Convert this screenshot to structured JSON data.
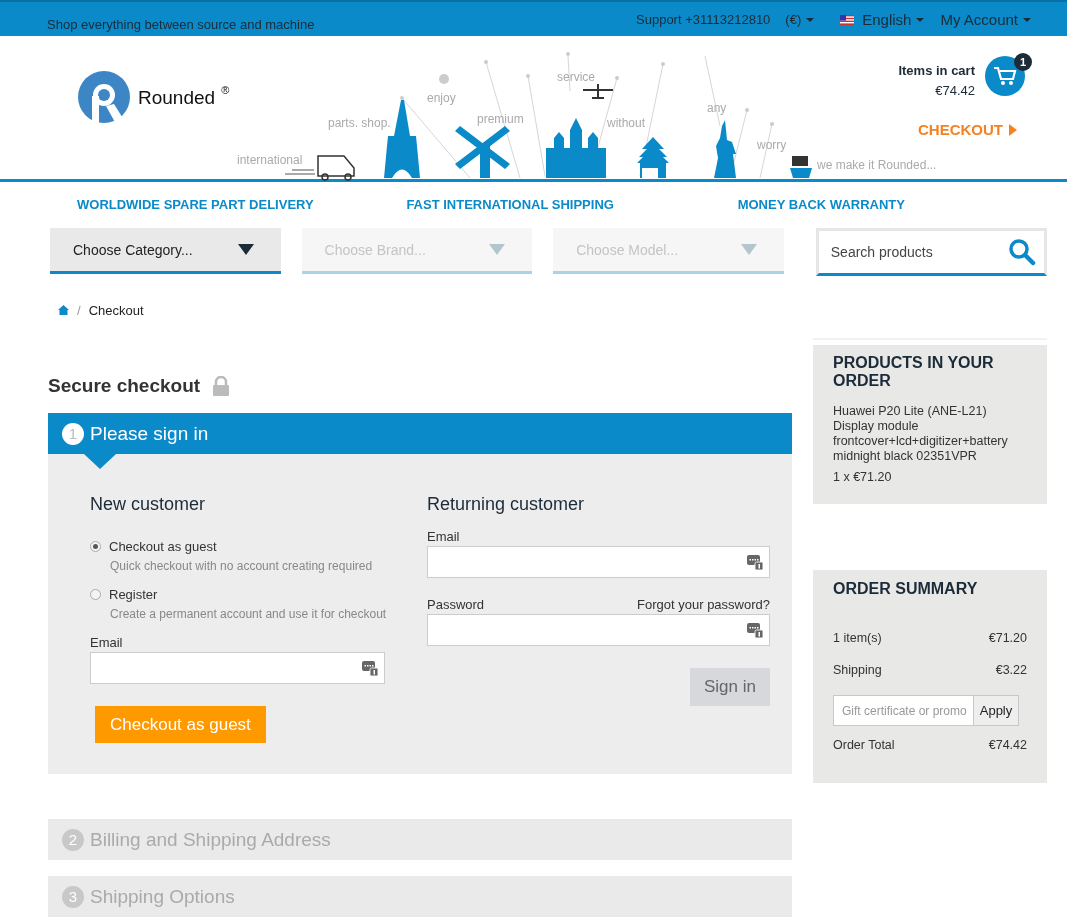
{
  "top_bar": {
    "tagline": "Shop everything between source and machine",
    "support": "Support +31113212810",
    "currency": "(€)",
    "language": "English",
    "account": "My Account"
  },
  "header": {
    "logo_text": "Rounded",
    "logo_mark": "®",
    "banner_words": [
      "international",
      "parts. shop.",
      "enjoy",
      "premium",
      "service",
      "without",
      "any",
      "worry",
      "we make it Rounded..."
    ],
    "cart": {
      "label": "Items in cart",
      "total": "€74.42",
      "count": "1"
    },
    "checkout": "CHECKOUT"
  },
  "features": [
    "WORLDWIDE SPARE PART DELIVERY",
    "FAST INTERNATIONAL SHIPPING",
    "MONEY BACK WARRANTY"
  ],
  "filters": [
    {
      "label": "Choose Category...",
      "disabled": false
    },
    {
      "label": "Choose Brand...",
      "disabled": true
    },
    {
      "label": "Choose Model...",
      "disabled": true
    }
  ],
  "search": {
    "placeholder": "Search products"
  },
  "breadcrumb": {
    "separator": "/",
    "items": [
      "Checkout"
    ]
  },
  "checkout": {
    "title": "Secure checkout",
    "steps": [
      {
        "number": "1",
        "title": "Please sign in",
        "active": true
      },
      {
        "number": "2",
        "title": "Billing and Shipping Address",
        "active": false
      },
      {
        "number": "3",
        "title": "Shipping Options",
        "active": false
      }
    ],
    "new_customer": {
      "heading": "New customer",
      "options": [
        {
          "label": "Checkout as guest",
          "description": "Quick checkout with no account creating required",
          "selected": true
        },
        {
          "label": "Register",
          "description": "Create a permanent account and use it for checkout",
          "selected": false
        }
      ],
      "email_label": "Email",
      "button": "Checkout as guest"
    },
    "returning_customer": {
      "heading": "Returning customer",
      "email_label": "Email",
      "password_label": "Password",
      "forgot": "Forgot your password?",
      "button": "Sign in"
    }
  },
  "sidebar": {
    "products": {
      "title": "PRODUCTS IN YOUR ORDER",
      "items": [
        {
          "name": "Huawei P20 Lite (ANE-L21) Display module frontcover+lcd+digitizer+battery midnight black 02351VPR",
          "qty_price": "1 x €71.20"
        }
      ]
    },
    "summary": {
      "title": "ORDER SUMMARY",
      "rows": [
        {
          "label": "1 item(s)",
          "value": "€71.20"
        },
        {
          "label": "Shipping",
          "value": "€3.22"
        }
      ],
      "promo": {
        "placeholder": "Gift certificate or promo",
        "button": "Apply"
      },
      "total_label": "Order Total",
      "total_value": "€74.42"
    }
  }
}
